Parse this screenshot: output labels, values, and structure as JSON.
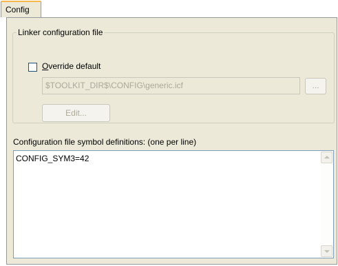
{
  "tabs": [
    {
      "label": "Config",
      "selected": true
    }
  ],
  "linker_group": {
    "title": "Linker configuration file",
    "override_checkbox": {
      "label": "Override default",
      "checked": false
    },
    "path_field": {
      "value": "$TOOLKIT_DIR$\\CONFIG\\generic.icf",
      "enabled": false
    },
    "browse_button_label": "...",
    "edit_button_label": "Edit..."
  },
  "symbol_definitions": {
    "label": "Configuration file symbol definitions: (one per line)",
    "text": "CONFIG_SYM3=42"
  },
  "colors": {
    "tab_highlight": "#f8b84e",
    "dialog_bg": "#ece9d8",
    "disabled_text": "#aca899"
  }
}
